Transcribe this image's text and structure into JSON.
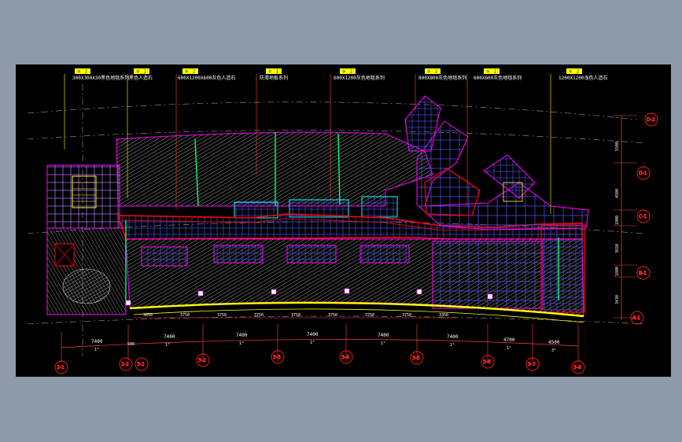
{
  "colors": {
    "background_window": "#8e9aaa",
    "drawing_background": "#000000",
    "wall": "#ff0000",
    "grid": "#4a4ae0",
    "hatch": "#9a9a9a",
    "outline": "#ff00ff",
    "glass": "#00ff80",
    "callout": "#ffff00",
    "axis": "#ff2020"
  },
  "callouts": [
    {
      "tag_a": "②",
      "tag_b": "2",
      "text": "300X300X30黑色地毯系列"
    },
    {
      "tag_a": "②",
      "tag_b": "2",
      "text": "黑色人造石"
    },
    {
      "tag_a": "②",
      "tag_b": "2",
      "text": "600X1200X600灰色人造石"
    },
    {
      "tag_a": "①",
      "tag_b": "1",
      "text": "防滑地板系列"
    },
    {
      "tag_a": "②",
      "tag_b": "2",
      "text": "600X1200灰色地毯系列"
    },
    {
      "tag_a": "②",
      "tag_b": "2",
      "text": "800X800灰色地毯系列"
    },
    {
      "tag_a": "②",
      "tag_b": "2",
      "text": "600X600灰色地毯系列"
    },
    {
      "tag_a": "②",
      "tag_b": "2",
      "text": "1200X1200浅色人造石"
    }
  ],
  "dimensions_inner": [
    "3050",
    "3750",
    "3750",
    "3750",
    "3750",
    "3750",
    "3750",
    "3750",
    "3350"
  ],
  "dimensions_bottom": [
    {
      "value": "7400",
      "sub": "1°"
    },
    {
      "value": "7400",
      "sub": "1°"
    },
    {
      "value": "7400",
      "sub": "1°"
    },
    {
      "value": "7400",
      "sub": "1°"
    },
    {
      "value": "7400",
      "sub": "1°"
    },
    {
      "value": "7400",
      "sub": "1°"
    },
    {
      "value": "4700",
      "sub": "1°"
    },
    {
      "value": "4500",
      "sub": "3°"
    }
  ],
  "dimension_marker_small": "500",
  "axes_bottom": [
    "2-1",
    "2-2",
    "3-1",
    "3-2",
    "3-3",
    "3-4",
    "3-5",
    "3-6",
    "3-7",
    "3-8"
  ],
  "dimensions_right": [
    "5500",
    "4500",
    "1800",
    "3650",
    "1800",
    "3430"
  ],
  "axes_right": [
    "D-2",
    "D-1",
    "C-1",
    "B-1",
    "A-1"
  ]
}
